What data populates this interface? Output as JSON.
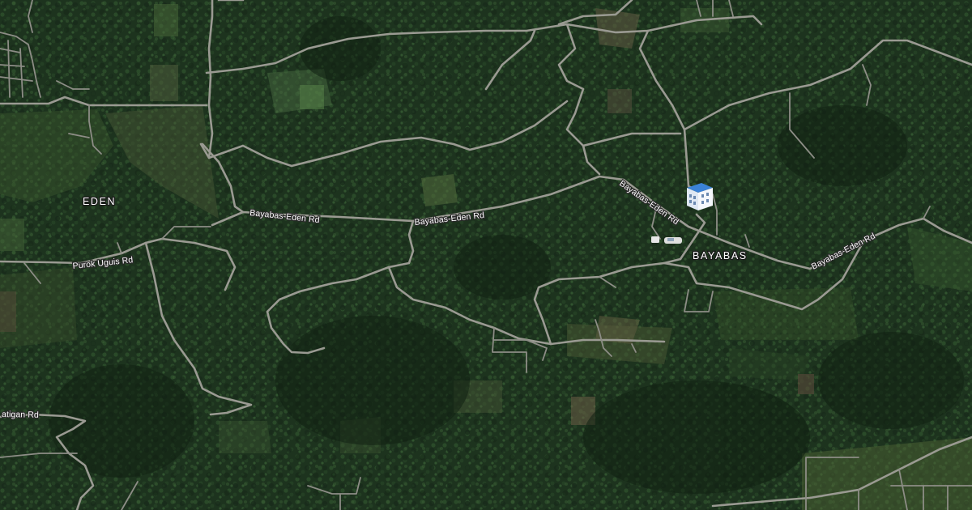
{
  "map": {
    "type": "satellite",
    "places": {
      "eden": "EDEN",
      "bayabas": "BAYABAS"
    },
    "roads": {
      "bayabas_eden_1": "Bayabas-Eden Rd",
      "bayabas_eden_2": "Bayabas-Eden Rd",
      "bayabas_eden_3": "Bayabas-Eden Rd",
      "bayabas_eden_4": "Bayabas-Eden Rd",
      "purok_uguis": "Purok Uguis Rd",
      "atigan": "atigan Rd"
    },
    "markers": {
      "school": "school-building-icon",
      "vehicle": "vehicle-icon"
    },
    "colors": {
      "road": "#9a9a92",
      "label_text": "#ffffff",
      "school_roof": "#3b82d6"
    }
  }
}
